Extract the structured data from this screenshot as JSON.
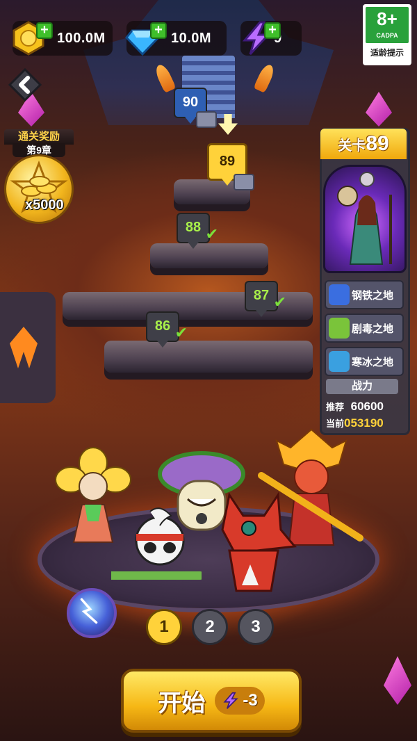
{
  "resources": {
    "gold": {
      "value": "100.0M",
      "icon": "gold-coin-icon"
    },
    "gems": {
      "value": "10.0M",
      "icon": "diamond-icon"
    },
    "energy": {
      "value": "9",
      "icon": "lightning-icon"
    }
  },
  "age_rating": {
    "number": "8+",
    "org": "CADPA",
    "label": "适龄提示"
  },
  "reward": {
    "title": "通关奖励",
    "chapter": "第9章",
    "amount": "x5000"
  },
  "levels": [
    {
      "number": "90",
      "state": "locked"
    },
    {
      "number": "89",
      "state": "current"
    },
    {
      "number": "88",
      "state": "cleared"
    },
    {
      "number": "87",
      "state": "cleared"
    },
    {
      "number": "86",
      "state": "cleared"
    }
  ],
  "stage_panel": {
    "label": "关卡",
    "number": "89",
    "terrains": [
      {
        "name": "钢铁之地",
        "color": "#3a6ee0"
      },
      {
        "name": "剧毒之地",
        "color": "#7ac43a"
      },
      {
        "name": "寒冰之地",
        "color": "#3aa0e0"
      }
    ],
    "power_title": "战力",
    "recommended_label": "推荐",
    "recommended_value": "60600",
    "current_label": "当前",
    "current_value": "053190"
  },
  "teams": [
    "1",
    "2",
    "3"
  ],
  "selected_team": "1",
  "start_button": {
    "label": "开始",
    "cost": "-3"
  },
  "colors": {
    "accent": "#ffd23a",
    "cleared": "#a8f04a",
    "locked": "#2e5fb3"
  }
}
